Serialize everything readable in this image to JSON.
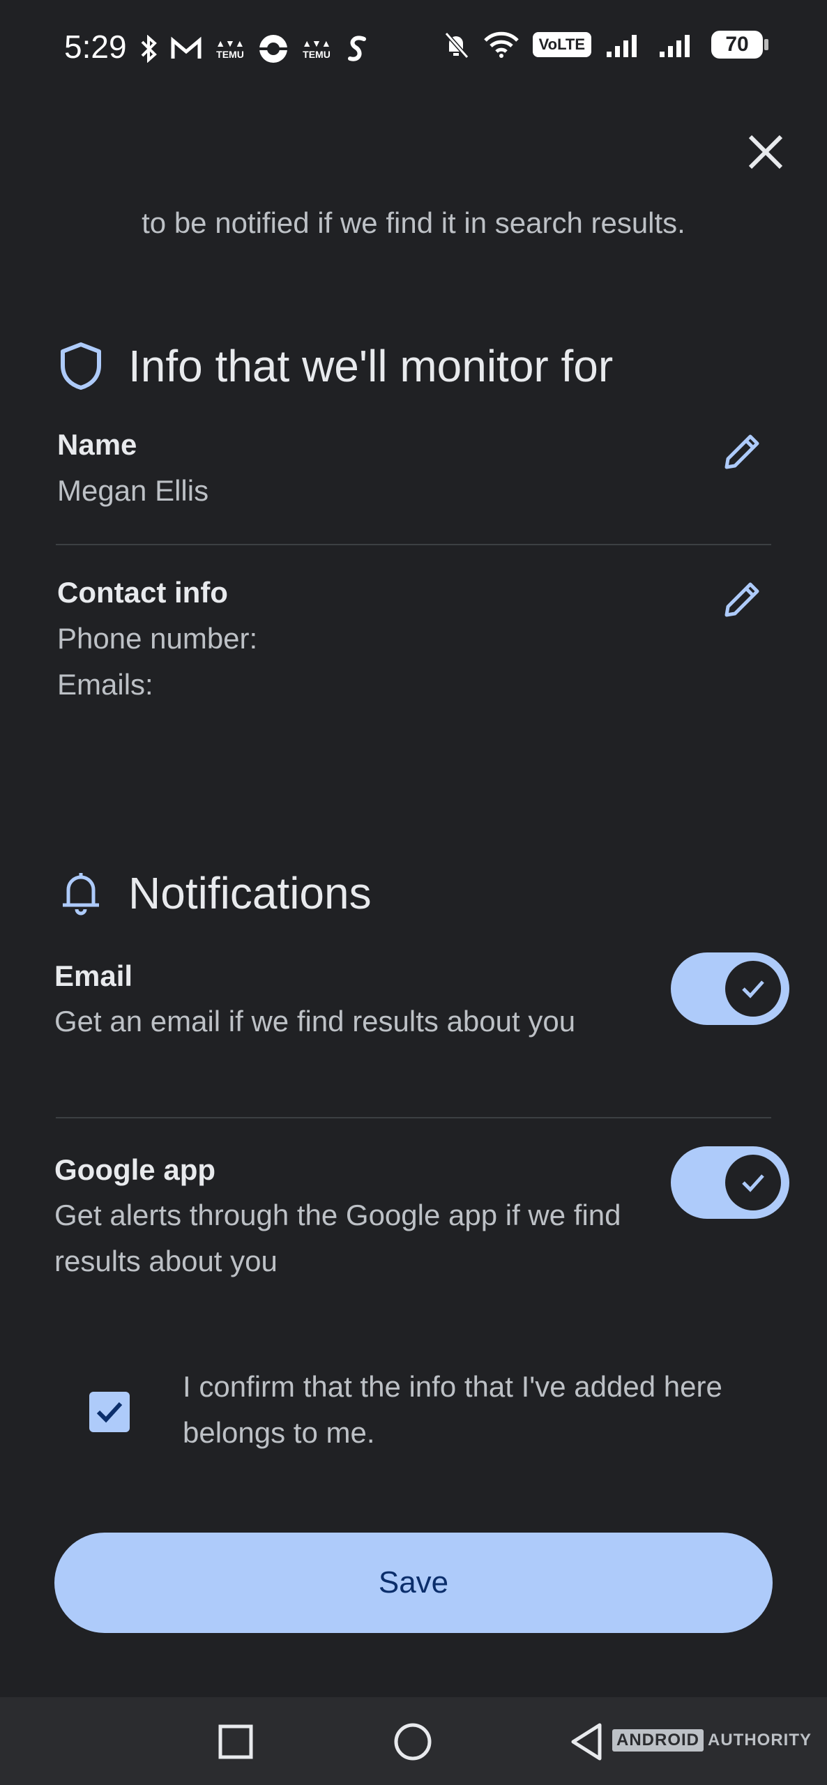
{
  "status_bar": {
    "time": "5:29",
    "left_icons": [
      "bluetooth-icon",
      "gmail-icon",
      "temu-icon",
      "circle-app-icon",
      "temu-icon",
      "shazam-icon"
    ],
    "temu_text": "TEMU",
    "volte": "VoLTE",
    "battery": "70"
  },
  "sheet": {
    "intro_text": "to be notified if we find it in search results.",
    "monitor_section": {
      "title": "Info that we'll monitor for",
      "name_label": "Name",
      "name_value": "Megan Ellis",
      "contact_label": "Contact info",
      "phone_label": "Phone number:",
      "emails_label": "Emails:"
    },
    "notifications_section": {
      "title": "Notifications",
      "email": {
        "label": "Email",
        "description": "Get an email if we find results about you",
        "enabled": true
      },
      "google_app": {
        "label": "Google app",
        "description": "Get alerts through the Google app if we find results about you",
        "enabled": true
      }
    },
    "confirm": {
      "text": "I confirm that the info that I've added here belongs to me.",
      "checked": true
    },
    "save_label": "Save"
  },
  "watermark": {
    "boxed": "ANDROID",
    "rest": "AUTHORITY"
  },
  "colors": {
    "background": "#202124",
    "accent": "#aecbfa",
    "accent_text": "#0b2e6b",
    "icon_blue": "#aecbfa"
  }
}
